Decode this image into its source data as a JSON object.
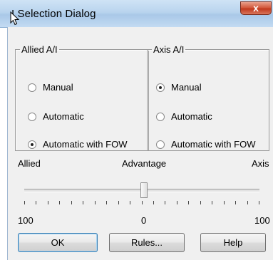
{
  "window": {
    "title": "I Selection Dialog",
    "close_glyph": "x"
  },
  "allied_group": {
    "legend": "Allied A/I",
    "options": [
      {
        "label": "Manual",
        "selected": false
      },
      {
        "label": "Automatic",
        "selected": false
      },
      {
        "label": "Automatic with FOW",
        "selected": true
      }
    ]
  },
  "axis_group": {
    "legend": "Axis A/I",
    "options": [
      {
        "label": "Manual",
        "selected": true
      },
      {
        "label": "Automatic",
        "selected": false
      },
      {
        "label": "Automatic with FOW",
        "selected": false
      }
    ]
  },
  "advantage": {
    "left_label": "Allied",
    "center_label": "Advantage",
    "right_label": "Axis",
    "min_label": "100",
    "mid_label": "0",
    "max_label": "100",
    "value": 0
  },
  "buttons": {
    "ok": "OK",
    "rules": "Rules...",
    "help": "Help"
  },
  "icons": {
    "cursor": "mouse-pointer-icon",
    "close": "close-icon"
  }
}
